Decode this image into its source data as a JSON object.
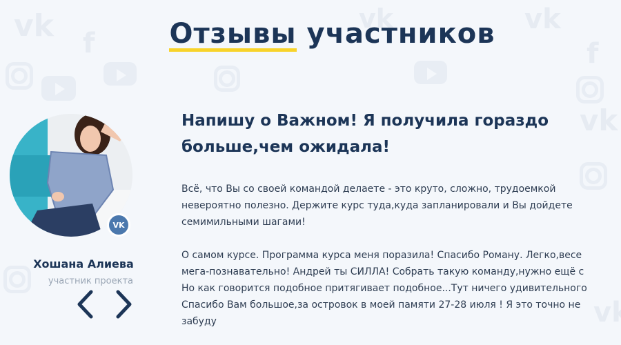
{
  "section": {
    "title_highlight": "Отзывы",
    "title_rest": "участников"
  },
  "reviewer": {
    "name": "Хошана Алиева",
    "role": "участник проекта",
    "social_badge": "VK"
  },
  "review": {
    "headline_line1": "Напишу о Важном! Я получила гораздо",
    "headline_line2": "больше,чем ожидала!",
    "paragraph1": [
      "Всё, что Вы со своей командой делаете - это круто, сложно, трудоемкой",
      "невероятно полезно. Держите курс туда,куда запланировали и Вы дойдете",
      "семимильными шагами!"
    ],
    "paragraph2": [
      "О самом курсе. Программа курса меня поразила! Спасибо Роману. Легко,весе",
      "мега-познавательно! Андрей ты СИЛЛА! Собрать такую команду,нужно ещё с",
      "Но как говорится подобное притягивает подобное...Тут ничего удивительного",
      "Спасибо Вам большое,за островок в моей памяти 27-28 июля ! Я это точно не",
      "забуду"
    ]
  },
  "navigation": {
    "prev_icon": "chevron-left-icon",
    "next_icon": "chevron-right-icon"
  },
  "colors": {
    "primary": "#1c3557",
    "accent": "#f8d32a",
    "vk": "#4b78ad",
    "muted": "#9aa6b5",
    "background": "#f4f7fb"
  }
}
